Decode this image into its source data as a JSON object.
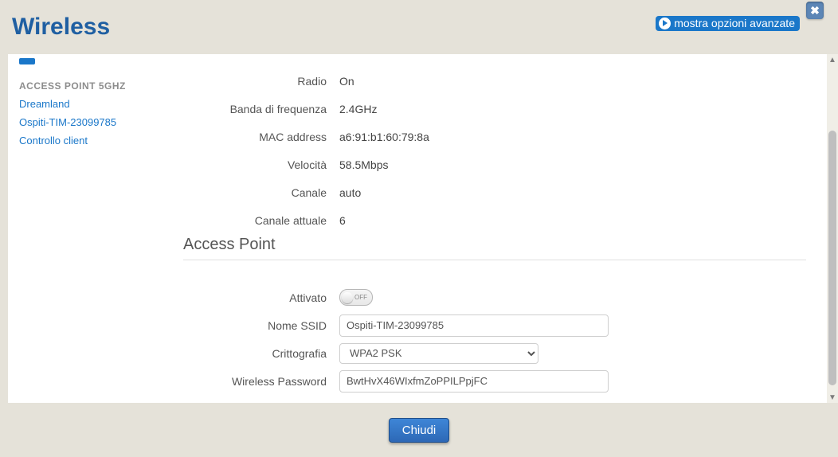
{
  "header": {
    "title": "Wireless",
    "show_advanced_label": "mostra opzioni avanzate"
  },
  "sidebar": {
    "active_trunc": "",
    "group_label": "ACCESS POINT 5GHZ",
    "links": [
      "Dreamland",
      "Ospiti-TIM-23099785",
      "Controllo client"
    ]
  },
  "info_rows": [
    {
      "label": "Radio",
      "value": "On"
    },
    {
      "label": "Banda di frequenza",
      "value": "2.4GHz"
    },
    {
      "label": "MAC address",
      "value": "a6:91:b1:60:79:8a"
    },
    {
      "label": "Velocità",
      "value": "58.5Mbps"
    },
    {
      "label": "Canale",
      "value": "auto"
    },
    {
      "label": "Canale attuale",
      "value": "6"
    }
  ],
  "section_title": "Access Point",
  "form": {
    "enabled_label": "Attivato",
    "enabled_state": "OFF",
    "ssid_label": "Nome SSID",
    "ssid_value": "Ospiti-TIM-23099785",
    "crypto_label": "Crittografia",
    "crypto_value": "WPA2 PSK",
    "pwd_label": "Wireless Password",
    "pwd_value": "BwtHvX46WIxfmZoPPILPpjFC"
  },
  "footer": {
    "close_label": "Chiudi"
  }
}
